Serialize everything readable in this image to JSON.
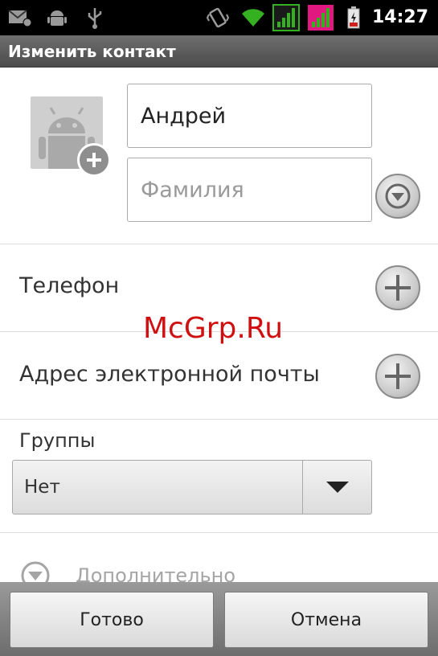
{
  "status_bar": {
    "time": "14:27",
    "icons": [
      "mail-icon",
      "android-debug-icon",
      "usb-icon",
      "vibrate-icon",
      "wifi-icon",
      "signal-icon",
      "signal-icon",
      "battery-charging-icon"
    ]
  },
  "header": {
    "title": "Изменить контакт"
  },
  "form": {
    "first_name_value": "Андрей",
    "last_name_placeholder": "Фамилия",
    "phone_label": "Телефон",
    "email_label": "Адрес электронной почты",
    "groups_label": "Группы",
    "groups_selected": "Нет",
    "more_label": "Дополнительно"
  },
  "watermark": {
    "text": "McGrp.Ru"
  },
  "footer": {
    "done_label": "Готово",
    "cancel_label": "Отмена"
  },
  "colors": {
    "status_bar_bg": "#000000",
    "title_bar_bg": "#5a5a5a",
    "signal_green": "#35b020",
    "signal_magenta": "#e01880",
    "watermark_red": "#d01010"
  }
}
